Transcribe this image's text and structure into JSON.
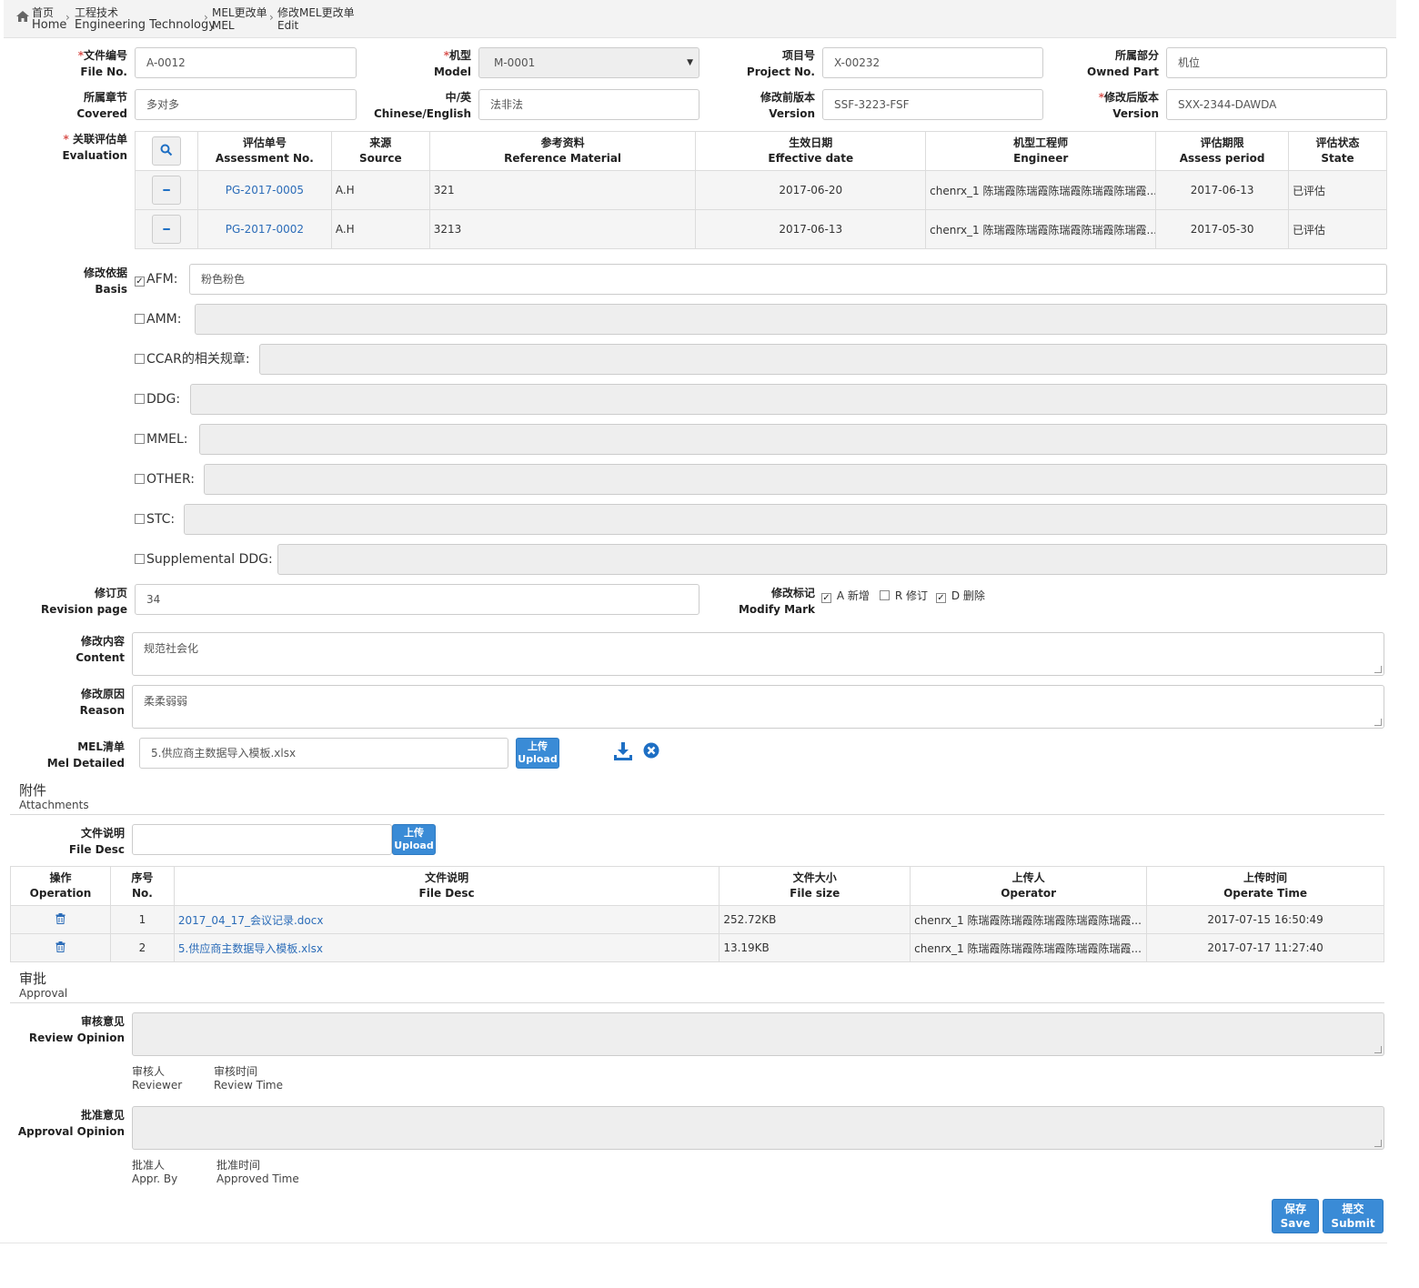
{
  "breadcrumb": {
    "items": [
      {
        "zh": "首页",
        "en": "Home"
      },
      {
        "zh": "工程技术",
        "en": "Engineering Technology"
      },
      {
        "zh": "MEL更改单",
        "en": "MEL"
      },
      {
        "zh": "修改MEL更改单",
        "en": "Edit"
      }
    ]
  },
  "form": {
    "file_no": {
      "zh": "文件编号",
      "en": "File No.",
      "value": "A-0012",
      "required": true
    },
    "model": {
      "zh": "机型",
      "en": "Model",
      "value": "M-0001",
      "required": true
    },
    "project_no": {
      "zh": "项目号",
      "en": "Project No.",
      "value": "X-00232"
    },
    "owned_part": {
      "zh": "所属部分",
      "en": "Owned Part",
      "value": "机位"
    },
    "covered": {
      "zh": "所属章节",
      "en": "Covered",
      "value": "多对多"
    },
    "chinese_english": {
      "zh": "中/英",
      "en": "Chinese/English",
      "value": "法非法"
    },
    "version_before": {
      "zh": "修改前版本",
      "en": "Version",
      "value": "SSF-3223-FSF"
    },
    "version_after": {
      "zh": "修改后版本",
      "en": "Version",
      "value": "SXX-2344-DAWDA",
      "required": true
    }
  },
  "evaluation": {
    "label": {
      "zh": "关联评估单",
      "en": "Evaluation"
    },
    "columns": [
      {
        "zh": "评估单号",
        "en": "Assessment No."
      },
      {
        "zh": "来源",
        "en": "Source"
      },
      {
        "zh": "参考资料",
        "en": "Reference Material"
      },
      {
        "zh": "生效日期",
        "en": "Effective date"
      },
      {
        "zh": "机型工程师",
        "en": "Engineer"
      },
      {
        "zh": "评估期限",
        "en": "Assess period"
      },
      {
        "zh": "评估状态",
        "en": "State"
      }
    ],
    "rows": [
      {
        "no": "PG-2017-0005",
        "source": "A.H",
        "ref": "321",
        "date": "2017-06-20",
        "engineer": "chenrx_1 陈瑞霞陈瑞霞陈瑞霞陈瑞霞陈瑞霞...",
        "period": "2017-06-13",
        "state": "已评估"
      },
      {
        "no": "PG-2017-0002",
        "source": "A.H",
        "ref": "3213",
        "date": "2017-06-13",
        "engineer": "chenrx_1 陈瑞霞陈瑞霞陈瑞霞陈瑞霞陈瑞霞...",
        "period": "2017-05-30",
        "state": "已评估"
      }
    ]
  },
  "basis": {
    "label": {
      "zh": "修改依据",
      "en": "Basis"
    },
    "items": [
      {
        "label": "AFM:",
        "checked": true,
        "value": "粉色粉色"
      },
      {
        "label": "AMM:",
        "checked": false,
        "value": ""
      },
      {
        "label": "CCAR的相关规章:",
        "checked": false,
        "value": ""
      },
      {
        "label": "DDG:",
        "checked": false,
        "value": ""
      },
      {
        "label": "MMEL:",
        "checked": false,
        "value": ""
      },
      {
        "label": "OTHER:",
        "checked": false,
        "value": ""
      },
      {
        "label": "STC:",
        "checked": false,
        "value": ""
      },
      {
        "label": "Supplemental DDG:",
        "checked": false,
        "value": ""
      }
    ]
  },
  "revision_page": {
    "zh": "修订页",
    "en": "Revision page",
    "value": "34"
  },
  "modify_mark": {
    "zh": "修改标记",
    "en": "Modify Mark",
    "options": [
      {
        "label": "A 新增",
        "checked": true
      },
      {
        "label": "R 修订",
        "checked": false
      },
      {
        "label": "D 删除",
        "checked": true
      }
    ]
  },
  "content": {
    "zh": "修改内容",
    "en": "Content",
    "value": "规范社会化"
  },
  "reason": {
    "zh": "修改原因",
    "en": "Reason",
    "value": "柔柔弱弱"
  },
  "mel_detailed": {
    "zh": "MEL清单",
    "en": "Mel Detailed",
    "value": "5.供应商主数据导入模板.xlsx"
  },
  "upload_btn": {
    "zh": "上传",
    "en": "Upload"
  },
  "attachments": {
    "title": {
      "zh": "附件",
      "en": "Attachments"
    },
    "file_desc": {
      "zh": "文件说明",
      "en": "File Desc",
      "value": ""
    },
    "columns": [
      {
        "zh": "操作",
        "en": "Operation"
      },
      {
        "zh": "序号",
        "en": "No."
      },
      {
        "zh": "文件说明",
        "en": "File Desc"
      },
      {
        "zh": "文件大小",
        "en": "File size"
      },
      {
        "zh": "上传人",
        "en": "Operator"
      },
      {
        "zh": "上传时间",
        "en": "Operate Time"
      }
    ],
    "rows": [
      {
        "no": "1",
        "desc": "2017_04_17_会议记录.docx",
        "size": "252.72KB",
        "operator": "chenrx_1 陈瑞霞陈瑞霞陈瑞霞陈瑞霞陈瑞霞...",
        "time": "2017-07-15 16:50:49"
      },
      {
        "no": "2",
        "desc": "5.供应商主数据导入模板.xlsx",
        "size": "13.19KB",
        "operator": "chenrx_1 陈瑞霞陈瑞霞陈瑞霞陈瑞霞陈瑞霞...",
        "time": "2017-07-17 11:27:40"
      }
    ]
  },
  "approval": {
    "title": {
      "zh": "审批",
      "en": "Approval"
    },
    "review_opinion": {
      "zh": "审核意见",
      "en": "Review Opinion",
      "value": ""
    },
    "reviewer": {
      "zh": "审核人",
      "en": "Reviewer"
    },
    "review_time": {
      "zh": "审核时间",
      "en": "Review Time"
    },
    "approval_opinion": {
      "zh": "批准意见",
      "en": "Approval Opinion",
      "value": ""
    },
    "appr_by": {
      "zh": "批准人",
      "en": "Appr. By"
    },
    "approved_time": {
      "zh": "批准时间",
      "en": "Approved Time"
    }
  },
  "actions": {
    "save": {
      "zh": "保存",
      "en": "Save"
    },
    "submit": {
      "zh": "提交",
      "en": "Submit"
    }
  },
  "colors": {
    "primary": "#3a8bd6",
    "link": "#2b6cb8",
    "required": "#d9534f",
    "disabled": "#eeeeee"
  }
}
